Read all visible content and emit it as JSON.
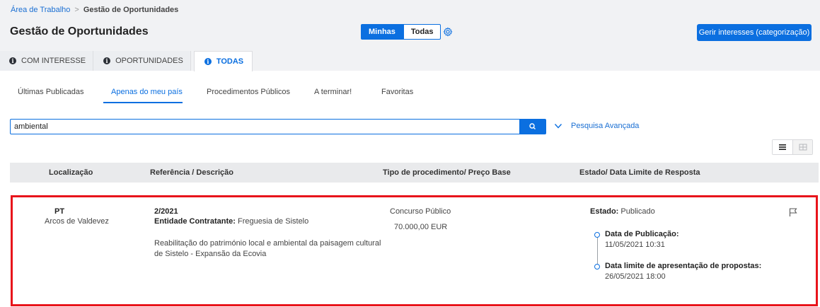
{
  "breadcrumb": {
    "root": "Área de Trabalho",
    "separator": ">",
    "current": "Gestão de Oportunidades"
  },
  "page_title": "Gestão de Oportunidades",
  "scope_toggle": {
    "mine": "Minhas",
    "all": "Todas"
  },
  "manage_button": "Gerir interesses (categorização)",
  "top_tabs": [
    {
      "label": "COM INTERESSE",
      "icon": "info-icon"
    },
    {
      "label": "OPORTUNIDADES",
      "icon": "info-icon"
    },
    {
      "label": "TODAS",
      "icon": "info-icon",
      "active": true
    }
  ],
  "sub_tabs": [
    {
      "label": "Últimas Publicadas"
    },
    {
      "label": "Apenas do meu país",
      "active": true
    },
    {
      "label": "Procedimentos Públicos"
    },
    {
      "label": "A terminar!"
    },
    {
      "label": "Favoritas"
    }
  ],
  "search": {
    "value": "ambiental",
    "advanced_label": "Pesquisa Avançada"
  },
  "table": {
    "headers": [
      "Localização",
      "Referência / Descrição",
      "Tipo de procedimento/ Preço Base",
      "Estado/ Data Limite de Resposta"
    ],
    "rows": [
      {
        "country": "PT",
        "city": "Arcos de Valdevez",
        "reference": "2/2021",
        "entity_label": "Entidade Contratante:",
        "entity": "Freguesia de Sistelo",
        "description_line1": "Reabilitação do património local e ambiental da paisagem cultural",
        "description_line2": "de Sistelo - Expansão da Ecovia",
        "procedure_type": "Concurso Público",
        "base_price": "70.000,00 EUR",
        "state_label": "Estado:",
        "state": "Publicado",
        "publication_label": "Data de Publicação:",
        "publication_date": "11/05/2021 10:31",
        "deadline_label": "Data limite de apresentação de propostas:",
        "deadline_date": "26/05/2021 18:00"
      }
    ]
  },
  "colors": {
    "accent": "#0b6fe0",
    "highlight": "#e8141b",
    "header_bg": "#f1f2f4"
  }
}
